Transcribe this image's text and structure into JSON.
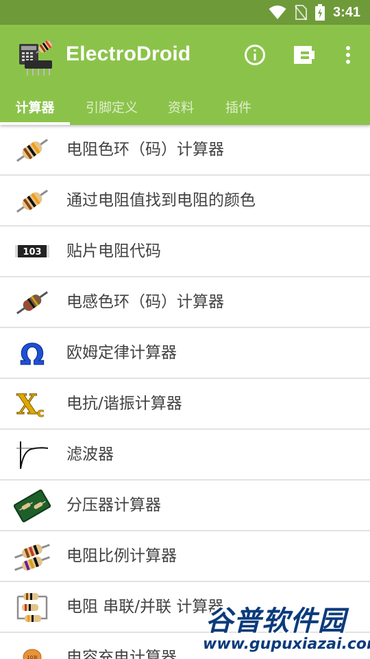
{
  "status_bar": {
    "time": "3:41",
    "icons": [
      "wifi-icon",
      "no-sim-icon",
      "battery-charging-icon"
    ]
  },
  "app_bar": {
    "title": "ElectroDroid",
    "actions": [
      "info-icon",
      "plug-connector-icon",
      "more-vert-icon"
    ],
    "color": "#8bc34a",
    "status_color": "#6f9a3a"
  },
  "tabs": [
    {
      "label": "计算器",
      "active": true
    },
    {
      "label": "引脚定义",
      "active": false
    },
    {
      "label": "资料",
      "active": false
    },
    {
      "label": "插件",
      "active": false
    }
  ],
  "list": [
    {
      "label": "电阻色环（码）计算器",
      "icon": "resistor-icon"
    },
    {
      "label": "通过电阻值找到电阻的颜色",
      "icon": "resistor-icon"
    },
    {
      "label": "贴片电阻代码",
      "icon": "smd-resistor-icon",
      "icon_text": "103"
    },
    {
      "label": "电感色环（码）计算器",
      "icon": "inductor-icon"
    },
    {
      "label": "欧姆定律计算器",
      "icon": "omega-icon"
    },
    {
      "label": "电抗/谐振计算器",
      "icon": "reactance-xc-icon"
    },
    {
      "label": "滤波器",
      "icon": "filter-curve-icon"
    },
    {
      "label": "分压器计算器",
      "icon": "voltage-divider-board-icon"
    },
    {
      "label": "电阻比例计算器",
      "icon": "resistor-pair-icon"
    },
    {
      "label": "电阻 串联/并联 计算器",
      "icon": "resistor-network-icon"
    },
    {
      "label": "电容充电计算器",
      "icon": "capacitor-icon"
    }
  ],
  "watermark": {
    "title": "谷普软件园",
    "url": "www.gupuxiazai.com"
  }
}
